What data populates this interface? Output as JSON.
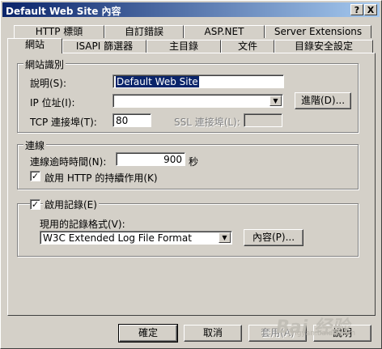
{
  "window": {
    "title": "Default Web Site 內容",
    "help_btn": "?",
    "close_btn": "X"
  },
  "tabs_back": [
    "HTTP 標頭",
    "自訂錯誤",
    "ASP.NET",
    "Server Extensions"
  ],
  "tabs_front": [
    "網站",
    "ISAPI 篩選器",
    "主目錄",
    "文件",
    "目錄安全設定"
  ],
  "site_id": {
    "legend": "網站識別",
    "desc_label": "說明(S):",
    "desc_value": "Default Web Site",
    "ip_label": "IP 位址(I):",
    "ip_value": "",
    "advanced_btn": "進階(D)...",
    "tcp_label": "TCP 連接埠(T):",
    "tcp_value": "80",
    "ssl_label": "SSL 連接埠(L):",
    "ssl_value": ""
  },
  "connection": {
    "legend": "連線",
    "timeout_label": "連線逾時時間(N):",
    "timeout_value": "900",
    "timeout_unit": "秒",
    "keepalive_label": "啟用 HTTP 的持續作用(K)",
    "keepalive_checked": true
  },
  "logging": {
    "enable_label": "啟用記錄(E)",
    "enable_checked": true,
    "format_label": "現用的記錄格式(V):",
    "format_value": "W3C Extended Log File Format",
    "props_btn": "內容(P)..."
  },
  "buttons": {
    "ok": "確定",
    "cancel": "取消",
    "apply": "套用(A)",
    "help": "說明"
  },
  "watermark": {
    "main": "Bai 经验",
    "sub": "jingyan.baidu.com"
  }
}
